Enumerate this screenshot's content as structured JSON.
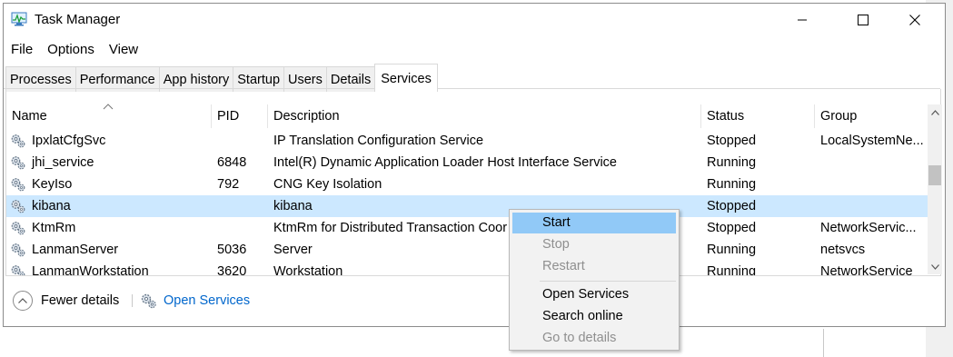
{
  "window": {
    "title": "Task Manager",
    "controls": {
      "minimize": "—",
      "maximize": "☐",
      "close": "✕"
    }
  },
  "menu": [
    "File",
    "Options",
    "View"
  ],
  "tabs": [
    {
      "label": "Processes",
      "active": false
    },
    {
      "label": "Performance",
      "active": false
    },
    {
      "label": "App history",
      "active": false
    },
    {
      "label": "Startup",
      "active": false
    },
    {
      "label": "Users",
      "active": false
    },
    {
      "label": "Details",
      "active": false
    },
    {
      "label": "Services",
      "active": true
    }
  ],
  "table": {
    "columns": [
      "Name",
      "PID",
      "Description",
      "Status",
      "Group"
    ],
    "sort": {
      "column": "Name",
      "direction": "ascending"
    },
    "rows": [
      {
        "name": "IpxlatCfgSvc",
        "pid": "",
        "description": "IP Translation Configuration Service",
        "status": "Stopped",
        "group": "LocalSystemNe...",
        "selected": false
      },
      {
        "name": "jhi_service",
        "pid": "6848",
        "description": "Intel(R) Dynamic Application Loader Host Interface Service",
        "status": "Running",
        "group": "",
        "selected": false
      },
      {
        "name": "KeyIso",
        "pid": "792",
        "description": "CNG Key Isolation",
        "status": "Running",
        "group": "",
        "selected": false
      },
      {
        "name": "kibana",
        "pid": "",
        "description": "kibana",
        "status": "Stopped",
        "group": "",
        "selected": true
      },
      {
        "name": "KtmRm",
        "pid": "",
        "description": "KtmRm for Distributed Transaction Coor",
        "status": "Stopped",
        "group": "NetworkServic...",
        "selected": false
      },
      {
        "name": "LanmanServer",
        "pid": "5036",
        "description": "Server",
        "status": "Running",
        "group": "netsvcs",
        "selected": false
      },
      {
        "name": "LanmanWorkstation",
        "pid": "3620",
        "description": "Workstation",
        "status": "Running",
        "group": "NetworkService",
        "selected": false
      }
    ]
  },
  "footer": {
    "fewer_details": "Fewer details",
    "open_services": "Open Services"
  },
  "context_menu": {
    "items": [
      {
        "label": "Start",
        "enabled": true,
        "highlighted": true
      },
      {
        "label": "Stop",
        "enabled": false,
        "highlighted": false
      },
      {
        "label": "Restart",
        "enabled": false,
        "highlighted": false
      },
      {
        "label": "Open Services",
        "enabled": true,
        "highlighted": false
      },
      {
        "label": "Search online",
        "enabled": true,
        "highlighted": false
      },
      {
        "label": "Go to details",
        "enabled": false,
        "highlighted": false
      }
    ]
  },
  "colors": {
    "selection": "#cce8ff",
    "menu_highlight": "#91c9f7",
    "link": "#0066cc",
    "disabled_text": "#8f8f8f"
  }
}
